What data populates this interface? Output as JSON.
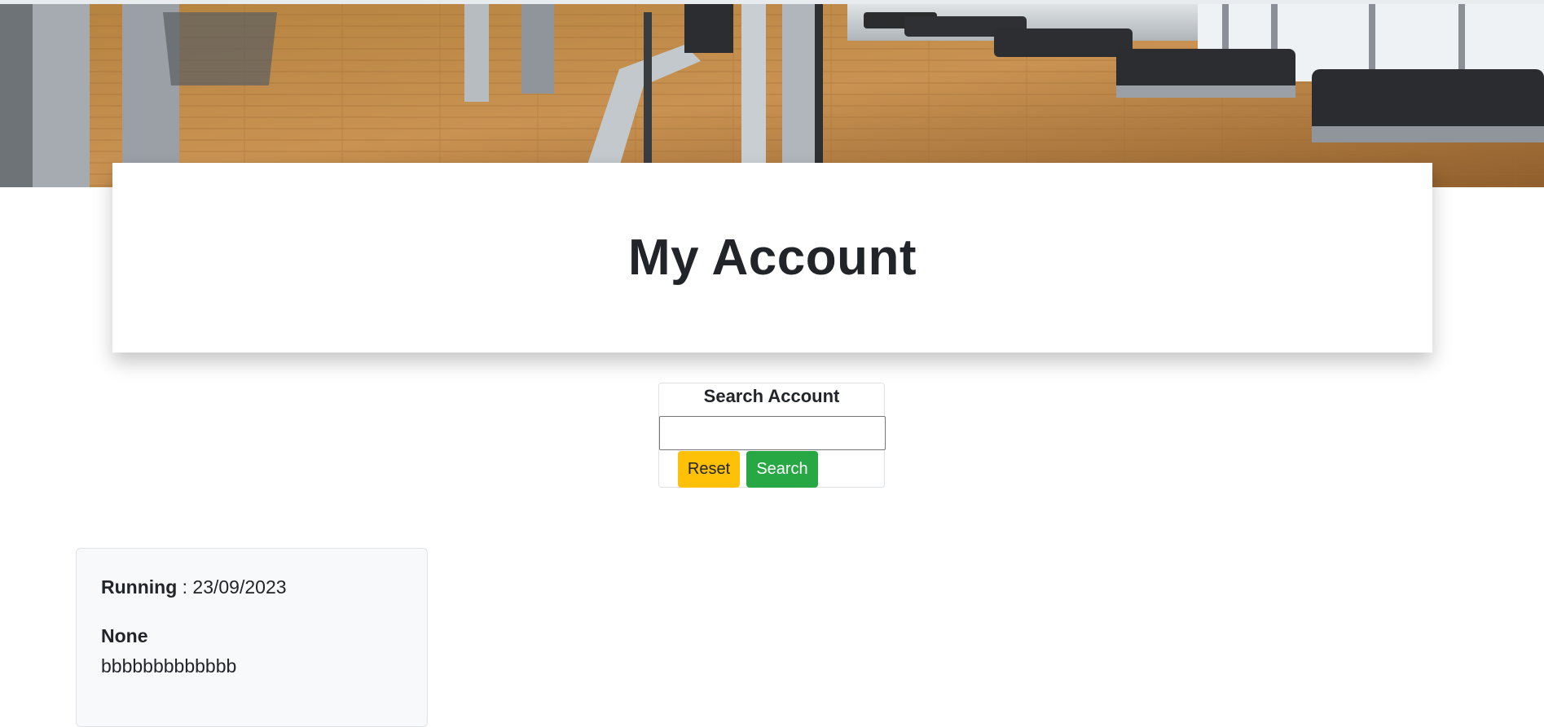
{
  "hero": {
    "image_alt": "gym-with-treadmills-banner"
  },
  "header": {
    "title": "My Account"
  },
  "search": {
    "title": "Search Account",
    "input_value": "",
    "reset_label": "Reset",
    "search_label": "Search",
    "reset_color": "#ffc107",
    "search_color": "#28a745"
  },
  "entries": [
    {
      "activity": "Running",
      "separator": " : ",
      "date": "23/09/2023",
      "subtitle": "None",
      "note": "bbbbbbbbbbbbb"
    }
  ]
}
